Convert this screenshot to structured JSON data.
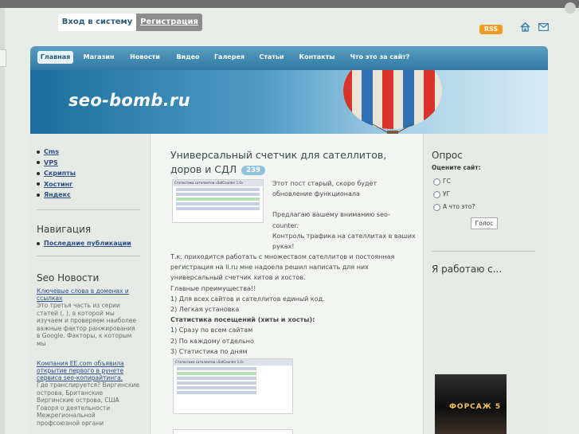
{
  "auth": {
    "login_tab": "Вход в систему",
    "register_tab": "Регистрация"
  },
  "header": {
    "rss_label": "RSS",
    "home_icon": "home-icon",
    "mail_icon": "mail-icon"
  },
  "nav": {
    "items": [
      "Главная",
      "Магазин",
      "Новости",
      "Видео",
      "Галерея",
      "Статьи",
      "Контакты",
      "Что это за сайт?"
    ],
    "active_index": 0
  },
  "banner": {
    "site_title": "seo-bomb.ru"
  },
  "left_sidebar": {
    "categories": [
      "Cms",
      "VPS",
      "Скрипты",
      "Хостинг",
      "Яндекс"
    ],
    "nav_heading": "Навигация",
    "nav_links": [
      "Последние публикации"
    ],
    "news_heading": "Seo Новости",
    "news": [
      {
        "title": "Ключевые слова в доменах и ссылках",
        "body": "Это третья часть из серии статей (. ), в которой мы изучаем и проверяем наиболее важные фактор ранжирования в Google. Факторы, к которым мы"
      },
      {
        "title": "Компания EE.com объявила открытие первого в рунете сервиса seo-копирайтинга.",
        "body": "Где транслируется? Виргинские острова, Британские Виргинские острова, США Говоря о деятельности Межрегиональной профсоюзной органи"
      }
    ]
  },
  "post": {
    "title": "Универсальный счетчик для сателлитов, доров и СДЛ",
    "views": "239",
    "intro_lines": [
      "Этот пост старый, скоро будет",
      "обновление функционала",
      "",
      "Предлагаю вашему вниманию seo-",
      "counter."
    ],
    "paragraph_1": "Контроль трафика на сателлитах в ваших руках!",
    "paragraph_2": "Т.к. приходится работать с множеством сателлитов и постоянная регистрация на li.ru мне надоела решил написать для них универсальный счетчик хитов и хостов.",
    "advantages_heading": "Главные преимущества!!",
    "advantages": [
      "1) Для всех сайтов и сателлитов единый код.",
      "2) Легкая установка"
    ],
    "stats_heading": "Статистика посещений (хиты и хосты):",
    "stats": [
      "1) Сразу по всем сайтам",
      "2) По каждому отдельно",
      "3) Статистика по дням"
    ],
    "thumb_caption": "Статистика сателлитов «SatCounter 1.0»"
  },
  "right_sidebar": {
    "poll_heading": "Опрос",
    "poll_question": "Оцените сайт:",
    "poll_options": [
      "ГС",
      "УГ",
      "А что это?"
    ],
    "vote_label": "Голос",
    "work_heading": "Я работаю с...",
    "poster_label": "ФОРСАЖ 5"
  },
  "colors": {
    "nav_gradient_top": "#5b9ec0",
    "nav_gradient_bottom": "#2f7aa3",
    "link": "#2d4f8a",
    "rss": "#f29a21",
    "badge": "#8fc3dc"
  }
}
